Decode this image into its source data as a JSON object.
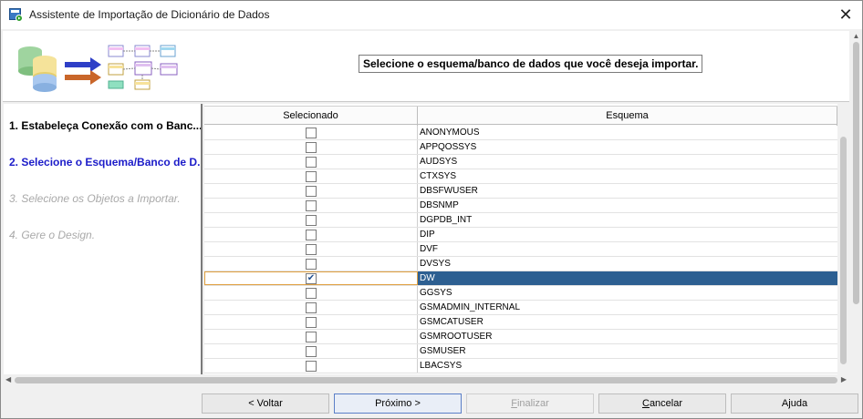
{
  "window": {
    "title": "Assistente de Importação de Dicionário de Dados",
    "close_label": "✕"
  },
  "header": {
    "instruction": "Selecione o esquema/banco de dados que você deseja importar."
  },
  "steps": [
    {
      "label": "1. Estabeleça Conexão com o Banc...",
      "state": "done"
    },
    {
      "label": "2. Selecione o Esquema/Banco de D...",
      "state": "active"
    },
    {
      "label": "3. Selecione os Objetos a Importar.",
      "state": "pending"
    },
    {
      "label": "4. Gere o Design.",
      "state": "pending"
    }
  ],
  "grid": {
    "columns": [
      "Selecionado",
      "Esquema"
    ],
    "rows": [
      {
        "schema": "ANONYMOUS",
        "checked": false
      },
      {
        "schema": "APPQOSSYS",
        "checked": false
      },
      {
        "schema": "AUDSYS",
        "checked": false
      },
      {
        "schema": "CTXSYS",
        "checked": false
      },
      {
        "schema": "DBSFWUSER",
        "checked": false
      },
      {
        "schema": "DBSNMP",
        "checked": false
      },
      {
        "schema": "DGPDB_INT",
        "checked": false
      },
      {
        "schema": "DIP",
        "checked": false
      },
      {
        "schema": "DVF",
        "checked": false
      },
      {
        "schema": "DVSYS",
        "checked": false
      },
      {
        "schema": "DW",
        "checked": true,
        "selected": true
      },
      {
        "schema": "GGSYS",
        "checked": false
      },
      {
        "schema": "GSMADMIN_INTERNAL",
        "checked": false
      },
      {
        "schema": "GSMCATUSER",
        "checked": false
      },
      {
        "schema": "GSMROOTUSER",
        "checked": false
      },
      {
        "schema": "GSMUSER",
        "checked": false
      },
      {
        "schema": "LBACSYS",
        "checked": false
      }
    ]
  },
  "buttons": {
    "back": "< Voltar",
    "next": "Próximo >",
    "finish_u": "F",
    "finish_rest": "inalizar",
    "cancel_u": "C",
    "cancel_rest": "ancelar",
    "help": "Ajuda"
  },
  "colors": {
    "selected_row": "#2d5f91",
    "active_step": "#1c1cc9",
    "pending_step": "#a9a9a9"
  }
}
